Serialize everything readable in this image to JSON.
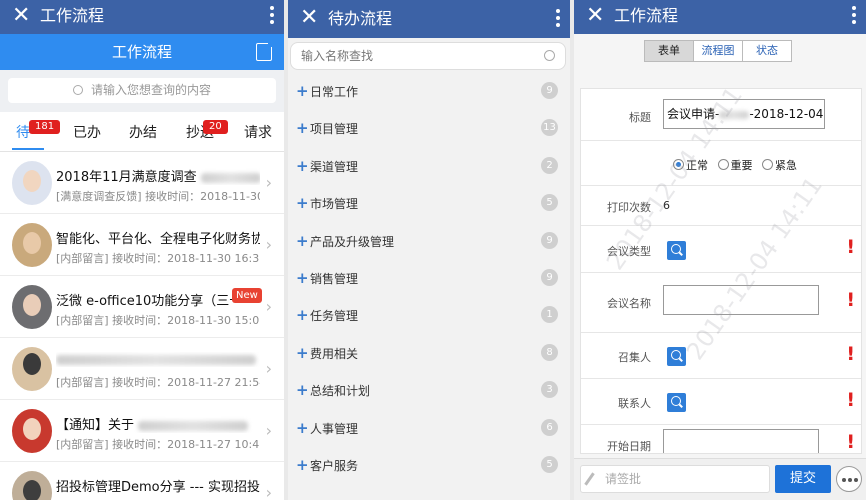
{
  "screen1": {
    "title": "工作流程",
    "header": "工作流程",
    "search_placeholder": "请输入您想查询的内容",
    "tabs": [
      {
        "label": "待",
        "badge": "181"
      },
      {
        "label": "已办",
        "badge": ""
      },
      {
        "label": "办结",
        "badge": ""
      },
      {
        "label": "抄送",
        "badge": "20"
      },
      {
        "label": "请求",
        "badge": ""
      }
    ],
    "messages": [
      {
        "title": "2018年11月满意度调查",
        "sub": "[满意度调查反馈] 接收时间：2018-11-30 19:...",
        "badge": ""
      },
      {
        "title": "智能化、平台化、全程电子化财务协同管...",
        "sub": "[内部留言] 接收时间：2018-11-30 16:31:54",
        "badge": ""
      },
      {
        "title": "泛微 e-office10功能分享（三十...",
        "sub": "[内部留言] 接收时间：2018-11-30 15:05:08",
        "badge": "New"
      },
      {
        "title": "",
        "sub": "[内部留言] 接收时间：2018-11-27 21:54:44",
        "badge": ""
      },
      {
        "title": "【通知】关于",
        "sub": "[内部留言] 接收时间：2018-11-27 10:43:31",
        "badge": ""
      },
      {
        "title": "招投标管理Demo分享 --- 实现招投标...",
        "sub": "",
        "badge": ""
      }
    ]
  },
  "screen2": {
    "title": "待办流程",
    "search_placeholder": "输入名称查找",
    "categories": [
      {
        "label": "日常工作",
        "count": "9"
      },
      {
        "label": "项目管理",
        "count": "13"
      },
      {
        "label": "渠道管理",
        "count": "2"
      },
      {
        "label": "市场管理",
        "count": "5"
      },
      {
        "label": "产品及升级管理",
        "count": "9"
      },
      {
        "label": "销售管理",
        "count": "9"
      },
      {
        "label": "任务管理",
        "count": "1"
      },
      {
        "label": "费用相关",
        "count": "8"
      },
      {
        "label": "总结和计划",
        "count": "3"
      },
      {
        "label": "人事管理",
        "count": "6"
      },
      {
        "label": "客户服务",
        "count": "5"
      }
    ]
  },
  "screen3": {
    "title": "工作流程",
    "segments": [
      "表单",
      "流程图",
      "状态"
    ],
    "form": {
      "title_label": "标题",
      "title_value": "会议申请-",
      "title_date": "-2018-12-04",
      "priority_options": [
        "正常",
        "重要",
        "紧急"
      ],
      "print_label": "打印次数",
      "print_value": "6",
      "meeting_type_label": "会议类型",
      "meeting_name_label": "会议名称",
      "convener_label": "召集人",
      "contact_label": "联系人",
      "start_date_label": "开始日期"
    },
    "watermark": "2018-12-04 14:11",
    "comment_placeholder": "请签批",
    "submit_label": "提交"
  },
  "colors": {
    "titlebar": "#3c62a6",
    "accent": "#2f8cf0",
    "badge": "#e0201f",
    "submit": "#1e72d8"
  }
}
